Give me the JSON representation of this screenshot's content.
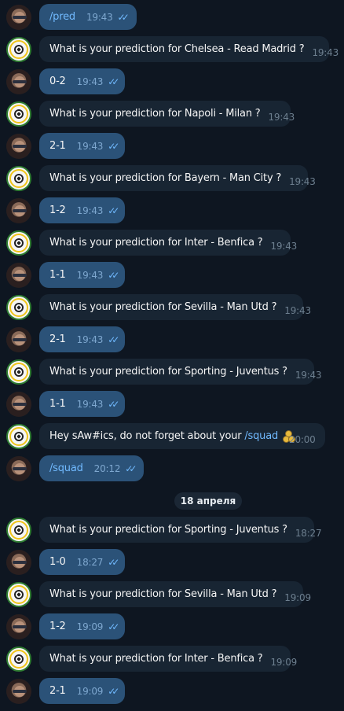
{
  "date_separator": "18 апреля",
  "messages": [
    {
      "from": "user",
      "text": "/pred",
      "time": "19:43",
      "is_command": true
    },
    {
      "from": "bot",
      "text": "What is your prediction for Chelsea - Read Madrid ?",
      "time": "19:43"
    },
    {
      "from": "user",
      "text": "0-2",
      "time": "19:43"
    },
    {
      "from": "bot",
      "text": "What is your prediction for Napoli - Milan ?",
      "time": "19:43"
    },
    {
      "from": "user",
      "text": "2-1",
      "time": "19:43"
    },
    {
      "from": "bot",
      "text": "What is your prediction for Bayern - Man City ?",
      "time": "19:43"
    },
    {
      "from": "user",
      "text": "1-2",
      "time": "19:43"
    },
    {
      "from": "bot",
      "text": "What is your prediction for Inter - Benfica ?",
      "time": "19:43"
    },
    {
      "from": "user",
      "text": "1-1",
      "time": "19:43"
    },
    {
      "from": "bot",
      "text": "What is your prediction for Sevilla - Man Utd ?",
      "time": "19:43"
    },
    {
      "from": "user",
      "text": "2-1",
      "time": "19:43"
    },
    {
      "from": "bot",
      "text": "What is your prediction for Sporting - Juventus ?",
      "time": "19:43"
    },
    {
      "from": "user",
      "text": "1-1",
      "time": "19:43"
    },
    {
      "from": "bot",
      "text_before": "Hey sAw#ics, do not forget about your ",
      "link": "/squad",
      "time": "20:00",
      "has_emoji": true
    },
    {
      "from": "user",
      "text": "/squad",
      "time": "20:12",
      "is_command": true
    },
    {
      "from": "bot",
      "text": "What is your prediction for Sporting - Juventus ?",
      "time": "18:27"
    },
    {
      "from": "user",
      "text": "1-0",
      "time": "18:27"
    },
    {
      "from": "bot",
      "text": "What is your prediction for Sevilla - Man Utd ?",
      "time": "19:09"
    },
    {
      "from": "user",
      "text": "1-2",
      "time": "19:09"
    },
    {
      "from": "bot",
      "text": "What is your prediction for Inter - Benfica ?",
      "time": "19:09"
    },
    {
      "from": "user",
      "text": "2-1",
      "time": "19:09"
    }
  ]
}
